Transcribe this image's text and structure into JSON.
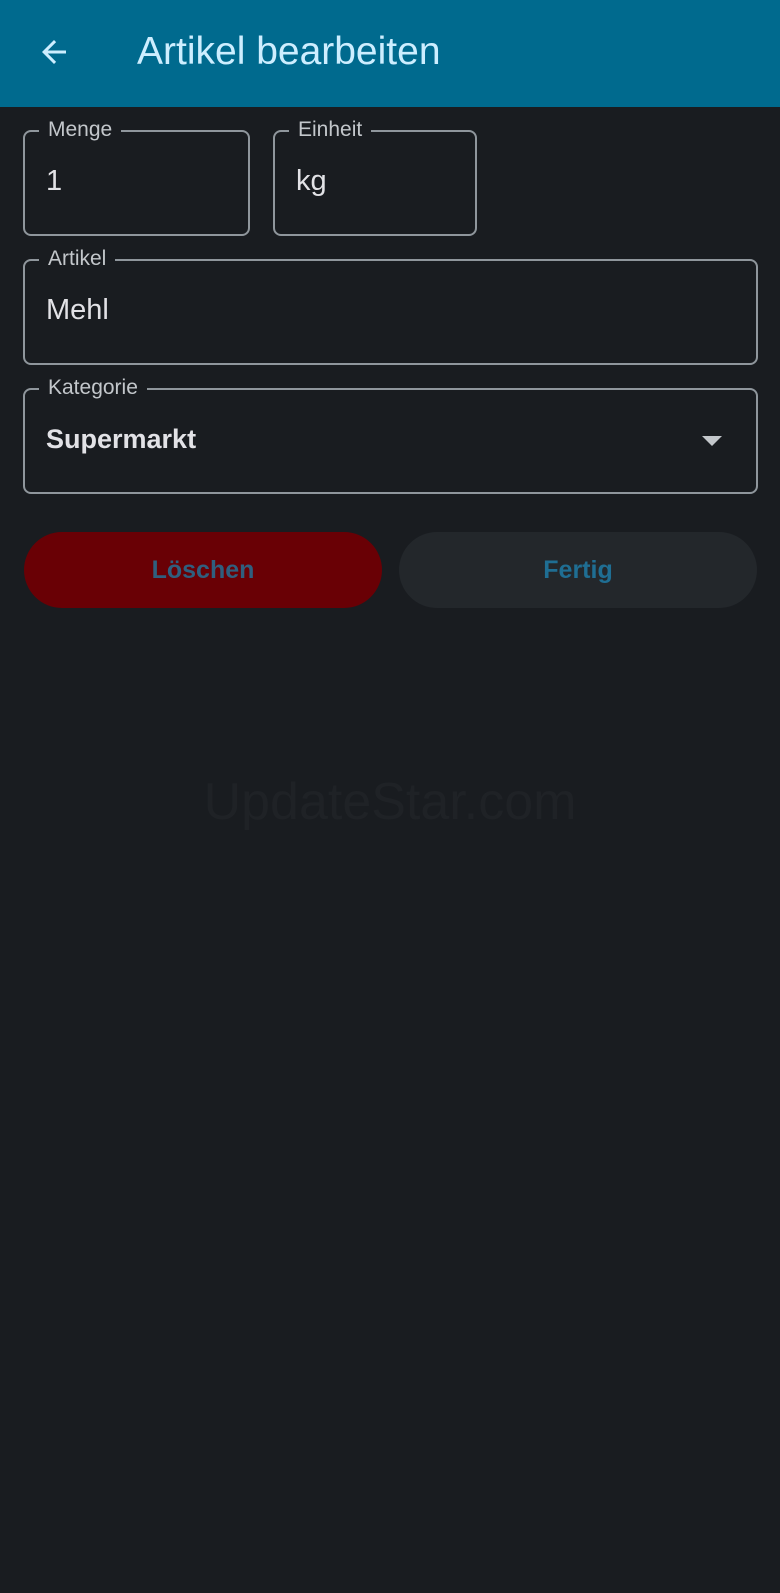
{
  "app_bar": {
    "back_icon": "arrow-left-icon",
    "title": "Artikel bearbeiten",
    "background_color": "#006a8e"
  },
  "form": {
    "quantity": {
      "label": "Menge",
      "value": "1"
    },
    "unit": {
      "label": "Einheit",
      "value": "kg"
    },
    "item": {
      "label": "Artikel",
      "value": "Mehl"
    },
    "category": {
      "label": "Kategorie",
      "selected": "Supermarkt",
      "icon": "dropdown-arrow-icon"
    }
  },
  "actions": {
    "delete_label": "Löschen",
    "delete_color": "#690005",
    "done_label": "Fertig"
  },
  "watermark": "UpdateStar.com"
}
